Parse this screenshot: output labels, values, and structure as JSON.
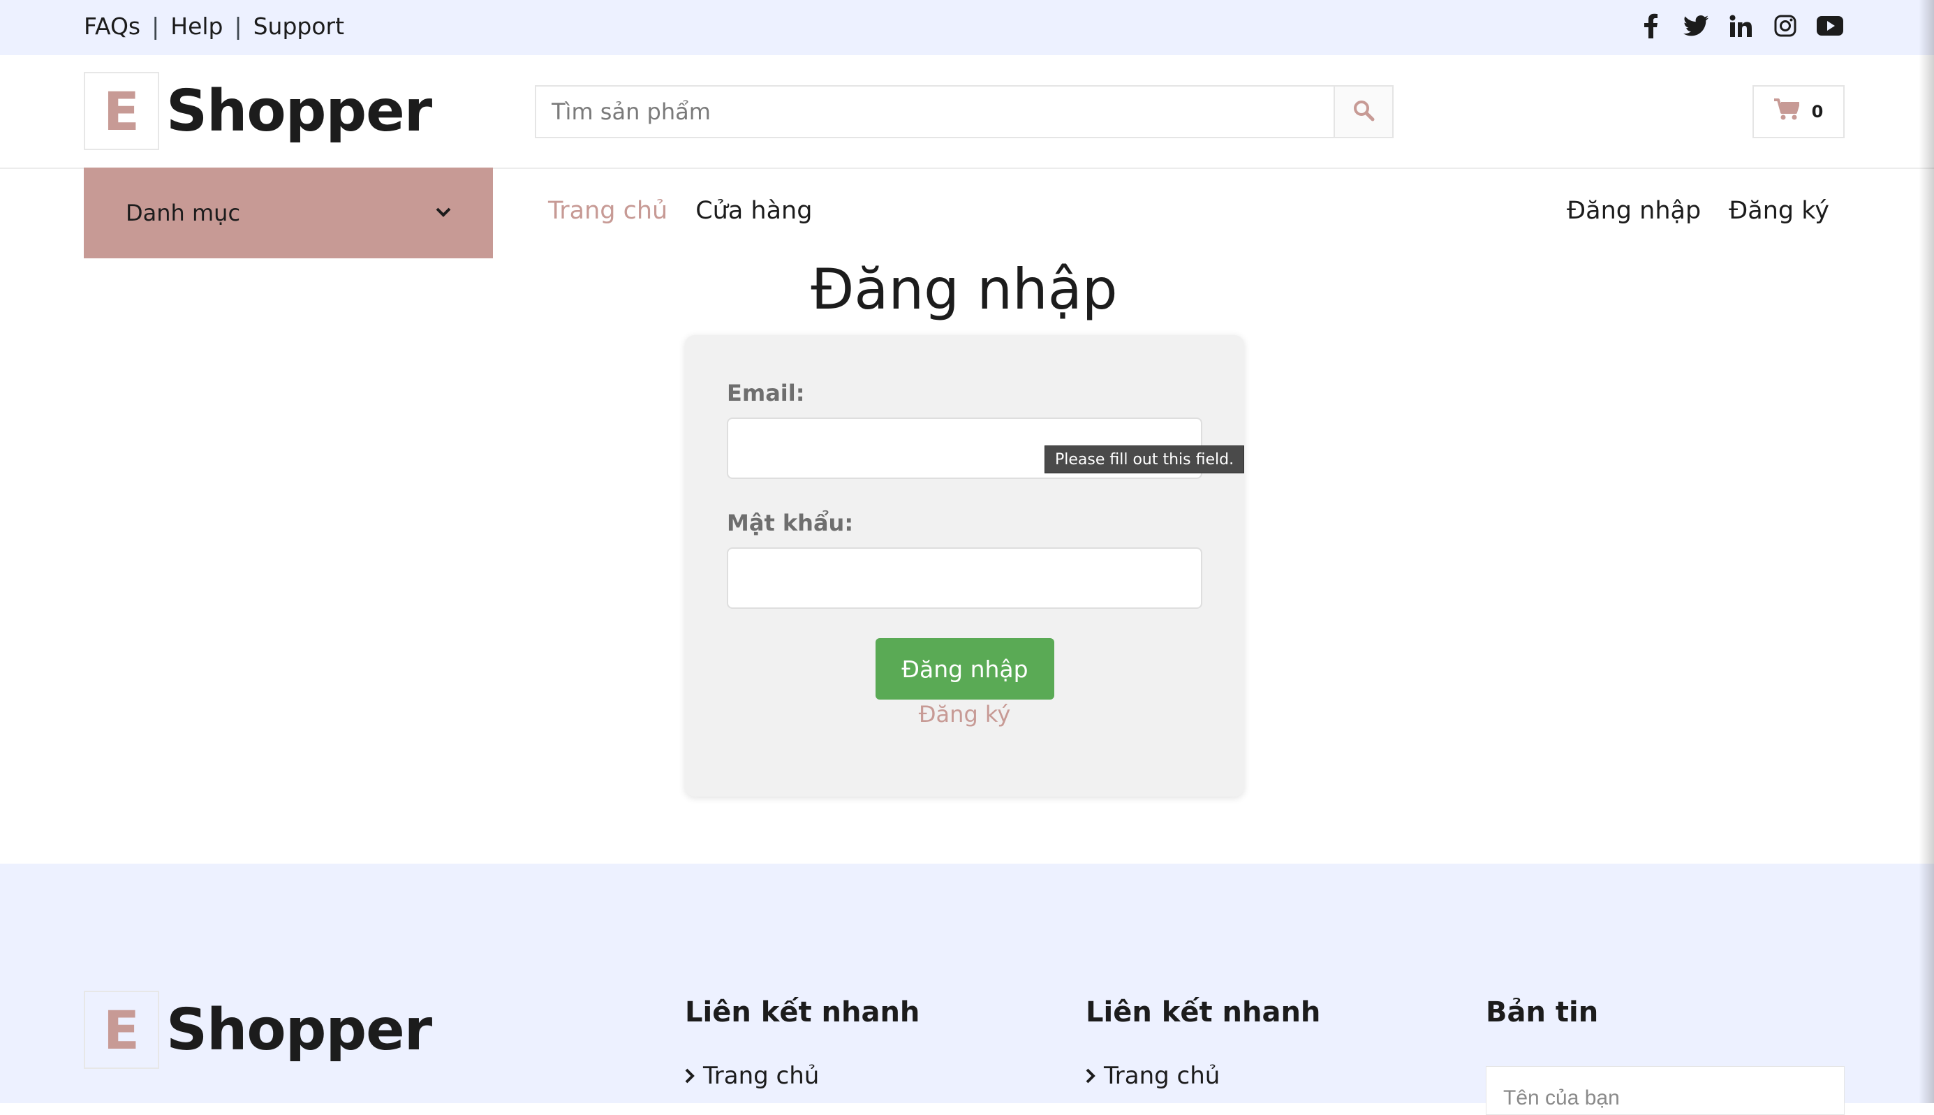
{
  "topbar": {
    "links": [
      "FAQs",
      "Help",
      "Support"
    ],
    "separator": "|",
    "social_icons": [
      "facebook-icon",
      "twitter-icon",
      "linkedin-icon",
      "instagram-icon",
      "youtube-icon"
    ]
  },
  "header": {
    "logo_letter": "E",
    "logo_text": "Shopper",
    "search_placeholder": "Tìm sản phẩm",
    "search_icon": "search-icon",
    "cart_icon": "shopping-cart-icon",
    "cart_count": "0"
  },
  "nav": {
    "category_label": "Danh mục",
    "main_links": [
      {
        "label": "Trang chủ",
        "active": true
      },
      {
        "label": "Cửa hàng",
        "active": false
      }
    ],
    "right_links": [
      "Đăng nhập",
      "Đăng ký"
    ]
  },
  "login": {
    "title": "Đăng nhập",
    "email_label": "Email:",
    "email_value": "",
    "password_label": "Mật khẩu:",
    "password_value": "",
    "tooltip": "Please fill out this field.",
    "submit_label": "Đăng nhập",
    "register_link": "Đăng ký"
  },
  "footer": {
    "logo_letter": "E",
    "logo_text": "Shopper",
    "col1_heading": "Liên kết nhanh",
    "col1_link": "Trang chủ",
    "col2_heading": "Liên kết nhanh",
    "col2_link": "Trang chủ",
    "col3_heading": "Bản tin",
    "newsletter_placeholder": "Tên của bạn"
  },
  "colors": {
    "accent": "#c79a95",
    "topbar_bg": "#edf1ff",
    "button_green": "#5aaa55",
    "text_dark": "#1c1c1c"
  }
}
